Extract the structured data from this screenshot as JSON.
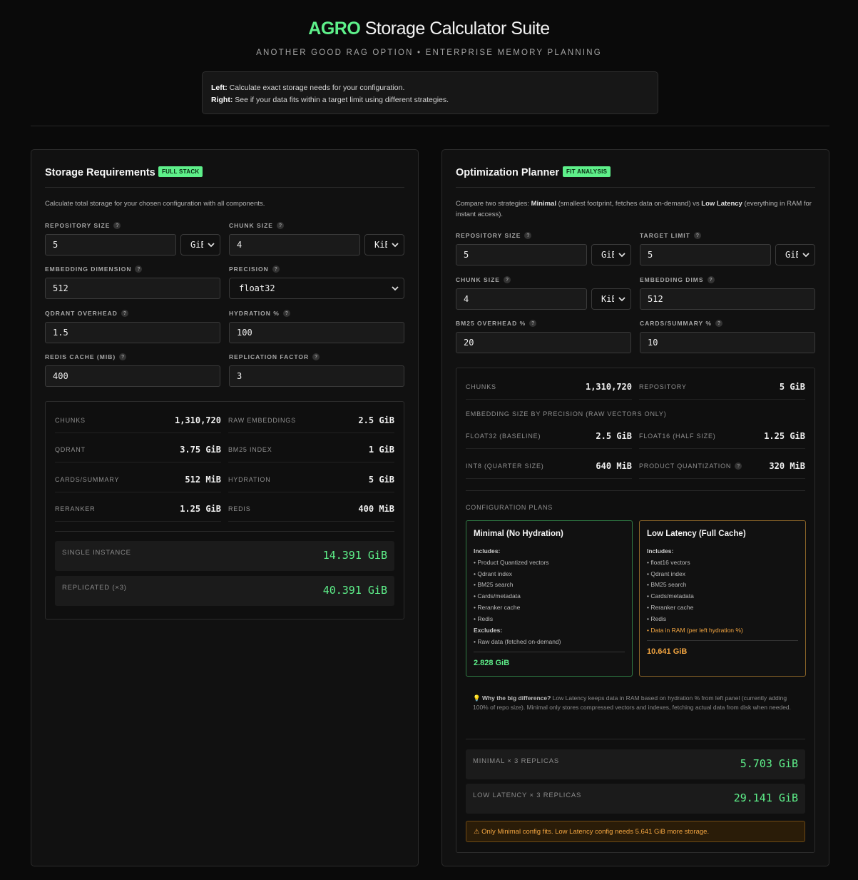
{
  "header": {
    "brand": "AGRO",
    "title_rest": " Storage Calculator Suite",
    "subtitle": "ANOTHER GOOD RAG OPTION • ENTERPRISE MEMORY PLANNING",
    "intro_left_label": "Left:",
    "intro_left_text": " Calculate exact storage needs for your configuration.",
    "intro_right_label": "Right:",
    "intro_right_text": " See if your data fits within a target limit using different strategies."
  },
  "left": {
    "title": "Storage Requirements",
    "badge": "FULL STACK",
    "description": "Calculate total storage for your chosen configuration with all components.",
    "fields": {
      "repo_size_label": "REPOSITORY SIZE",
      "repo_size_value": "5",
      "repo_size_unit": "GiB",
      "chunk_size_label": "CHUNK SIZE",
      "chunk_size_value": "4",
      "chunk_size_unit": "KiB",
      "embed_dim_label": "EMBEDDING DIMENSION",
      "embed_dim_value": "512",
      "precision_label": "PRECISION",
      "precision_value": "float32",
      "qdrant_label": "QDRANT OVERHEAD",
      "qdrant_value": "1.5",
      "hydration_label": "HYDRATION %",
      "hydration_value": "100",
      "redis_label": "REDIS CACHE (MIB)",
      "redis_value": "400",
      "replication_label": "REPLICATION FACTOR",
      "replication_value": "3"
    },
    "results": {
      "chunks_label": "CHUNKS",
      "chunks_value": "1,310,720",
      "raw_label": "RAW EMBEDDINGS",
      "raw_value": "2.5 GiB",
      "qdrant_label": "QDRANT",
      "qdrant_value": "3.75 GiB",
      "bm25_label": "BM25 INDEX",
      "bm25_value": "1 GiB",
      "cards_label": "CARDS/SUMMARY",
      "cards_value": "512 MiB",
      "hydration_label": "HYDRATION",
      "hydration_value": "5 GiB",
      "reranker_label": "RERANKER",
      "reranker_value": "1.25 GiB",
      "redis_label": "REDIS",
      "redis_value": "400 MiB"
    },
    "totals": {
      "single_label": "SINGLE INSTANCE",
      "single_value": "14.391 GiB",
      "replicated_label": "REPLICATED (×3)",
      "replicated_value": "40.391 GiB"
    }
  },
  "right": {
    "title": "Optimization Planner",
    "badge": "FIT ANALYSIS",
    "desc_1": "Compare two strategies: ",
    "desc_minimal": "Minimal",
    "desc_2": " (smallest footprint, fetches data on-demand) vs ",
    "desc_lowlat": "Low Latency",
    "desc_3": " (everything in RAM for instant access).",
    "fields": {
      "repo_size_label": "REPOSITORY SIZE",
      "repo_size_value": "5",
      "repo_size_unit": "GiB",
      "target_label": "TARGET LIMIT",
      "target_value": "5",
      "target_unit": "GiB",
      "chunk_size_label": "CHUNK SIZE",
      "chunk_size_value": "4",
      "chunk_size_unit": "KiB",
      "embed_dims_label": "EMBEDDING DIMS",
      "embed_dims_value": "512",
      "bm25_label": "BM25 OVERHEAD %",
      "bm25_value": "20",
      "cards_label": "CARDS/SUMMARY %",
      "cards_value": "10"
    },
    "results": {
      "chunks_label": "CHUNKS",
      "chunks_value": "1,310,720",
      "repo_label": "REPOSITORY",
      "repo_value": "5 GiB",
      "precision_heading": "EMBEDDING SIZE BY PRECISION (RAW VECTORS ONLY)",
      "f32_label": "FLOAT32 (BASELINE)",
      "f32_value": "2.5 GiB",
      "f16_label": "FLOAT16 (HALF SIZE)",
      "f16_value": "1.25 GiB",
      "int8_label": "INT8 (QUARTER SIZE)",
      "int8_value": "640 MiB",
      "pq_label": "PRODUCT QUANTIZATION",
      "pq_value": "320 MiB",
      "plans_heading": "CONFIGURATION PLANS"
    },
    "plan_minimal": {
      "title": "Minimal (No Hydration)",
      "includes_label": "Includes:",
      "includes": [
        "• Product Quantized vectors",
        "• Qdrant index",
        "• BM25 search",
        "• Cards/metadata",
        "• Reranker cache",
        "• Redis"
      ],
      "excludes_label": "Excludes:",
      "excludes": [
        "• Raw data (fetched on-demand)"
      ],
      "total": "2.828 GiB"
    },
    "plan_lowlat": {
      "title": "Low Latency (Full Cache)",
      "includes_label": "Includes:",
      "includes": [
        "• float16 vectors",
        "• Qdrant index",
        "• BM25 search",
        "• Cards/metadata",
        "• Reranker cache",
        "• Redis"
      ],
      "warn_item": "• Data in RAM (per left hydration %)",
      "total": "10.641 GiB"
    },
    "note": {
      "icon": "💡",
      "bold": "Why the big difference?",
      "text": " Low Latency keeps data in RAM based on hydration % from left panel (currently adding 100% of repo size). Minimal only stores compressed vectors and indexes, fetching actual data from disk when needed."
    },
    "totals": {
      "minimal_label": "MINIMAL × 3 REPLICAS",
      "minimal_value": "5.703 GiB",
      "lowlat_label": "LOW LATENCY × 3 REPLICAS",
      "lowlat_value": "29.141 GiB"
    },
    "warning": "⚠ Only Minimal config fits. Low Latency config needs 5.641 GiB more storage."
  },
  "colors": {
    "accent": "#5ef08a",
    "warning": "#f2a541",
    "background": "#0a0a0a",
    "panel": "#111111"
  }
}
